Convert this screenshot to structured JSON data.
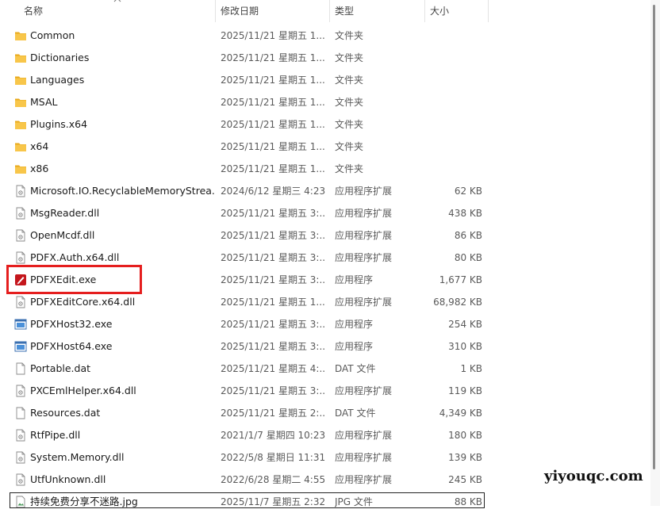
{
  "header": {
    "name": "名称",
    "date": "修改日期",
    "type": "类型",
    "size": "大小"
  },
  "files": [
    {
      "name": "Common",
      "date": "2025/11/21 星期五 1...",
      "type": "文件夹",
      "size": "",
      "icon": "folder-icon"
    },
    {
      "name": "Dictionaries",
      "date": "2025/11/21 星期五 1...",
      "type": "文件夹",
      "size": "",
      "icon": "folder-icon"
    },
    {
      "name": "Languages",
      "date": "2025/11/21 星期五 1...",
      "type": "文件夹",
      "size": "",
      "icon": "folder-icon"
    },
    {
      "name": "MSAL",
      "date": "2025/11/21 星期五 1...",
      "type": "文件夹",
      "size": "",
      "icon": "folder-icon"
    },
    {
      "name": "Plugins.x64",
      "date": "2025/11/21 星期五 1...",
      "type": "文件夹",
      "size": "",
      "icon": "folder-icon"
    },
    {
      "name": "x64",
      "date": "2025/11/21 星期五 1...",
      "type": "文件夹",
      "size": "",
      "icon": "folder-icon"
    },
    {
      "name": "x86",
      "date": "2025/11/21 星期五 1...",
      "type": "文件夹",
      "size": "",
      "icon": "folder-icon"
    },
    {
      "name": "Microsoft.IO.RecyclableMemoryStrea...",
      "date": "2024/6/12 星期三 4:23",
      "type": "应用程序扩展",
      "size": "62 KB",
      "icon": "dll-file-icon"
    },
    {
      "name": "MsgReader.dll",
      "date": "2025/11/21 星期五 3:...",
      "type": "应用程序扩展",
      "size": "438 KB",
      "icon": "dll-file-icon"
    },
    {
      "name": "OpenMcdf.dll",
      "date": "2025/11/21 星期五 3:...",
      "type": "应用程序扩展",
      "size": "86 KB",
      "icon": "dll-file-icon"
    },
    {
      "name": "PDFX.Auth.x64.dll",
      "date": "2025/11/21 星期五 3:...",
      "type": "应用程序扩展",
      "size": "80 KB",
      "icon": "dll-file-icon"
    },
    {
      "name": "PDFXEdit.exe",
      "date": "2025/11/21 星期五 3:...",
      "type": "应用程序",
      "size": "1,677 KB",
      "icon": "pdfxedit-app-icon"
    },
    {
      "name": "PDFXEditCore.x64.dll",
      "date": "2025/11/21 星期五 1...",
      "type": "应用程序扩展",
      "size": "68,982 KB",
      "icon": "dll-file-icon"
    },
    {
      "name": "PDFXHost32.exe",
      "date": "2025/11/21 星期五 3:...",
      "type": "应用程序",
      "size": "254 KB",
      "icon": "exe-window-icon"
    },
    {
      "name": "PDFXHost64.exe",
      "date": "2025/11/21 星期五 3:...",
      "type": "应用程序",
      "size": "310 KB",
      "icon": "exe-window-icon"
    },
    {
      "name": "Portable.dat",
      "date": "2025/11/21 星期五 4:...",
      "type": "DAT 文件",
      "size": "1 KB",
      "icon": "blank-file-icon"
    },
    {
      "name": "PXCEmlHelper.x64.dll",
      "date": "2025/11/21 星期五 3:...",
      "type": "应用程序扩展",
      "size": "119 KB",
      "icon": "dll-file-icon"
    },
    {
      "name": "Resources.dat",
      "date": "2025/11/21 星期五 2:...",
      "type": "DAT 文件",
      "size": "4,349 KB",
      "icon": "blank-file-icon"
    },
    {
      "name": "RtfPipe.dll",
      "date": "2021/1/7 星期四 10:23",
      "type": "应用程序扩展",
      "size": "180 KB",
      "icon": "dll-file-icon"
    },
    {
      "name": "System.Memory.dll",
      "date": "2022/5/8 星期日 11:31",
      "type": "应用程序扩展",
      "size": "139 KB",
      "icon": "dll-file-icon"
    },
    {
      "name": "UtfUnknown.dll",
      "date": "2022/6/28 星期二 4:55",
      "type": "应用程序扩展",
      "size": "245 KB",
      "icon": "dll-file-icon"
    },
    {
      "name": "持续免费分享不迷路.jpg",
      "date": "2025/11/7 星期五 2:32",
      "type": "JPG 文件",
      "size": "88 KB",
      "icon": "image-file-icon"
    }
  ],
  "watermark": "yiyouqc.com",
  "colors": {
    "highlight": "#e51e1e",
    "folder": "#f8c64a",
    "pdfx_red": "#c4161c"
  }
}
